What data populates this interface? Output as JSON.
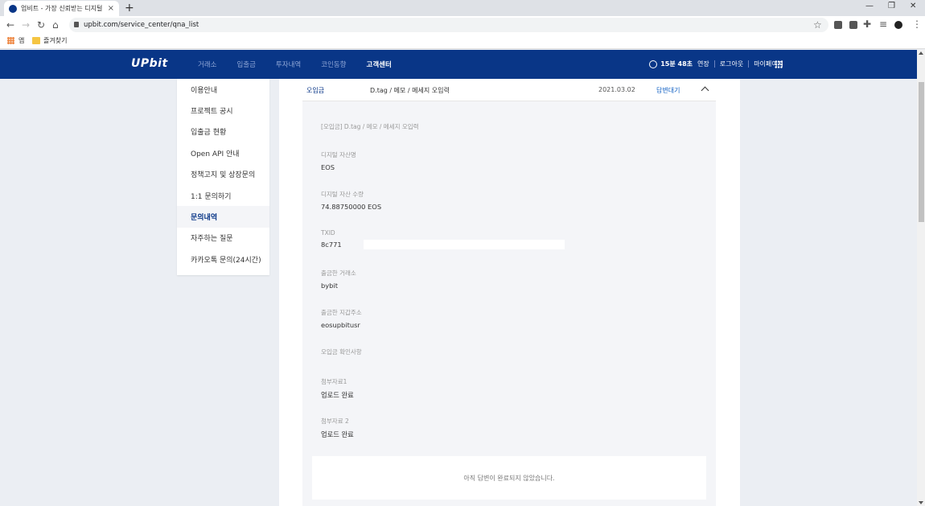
{
  "browser": {
    "tab_title": "업비트 - 가장 신뢰받는 디지털",
    "url": "upbit.com/service_center/qna_list",
    "bookmarks": {
      "apps_label": "앱",
      "folder_label": "즐겨찾기"
    }
  },
  "header": {
    "logo": "UPbit",
    "nav": [
      "거래소",
      "입출금",
      "투자내역",
      "코인동향",
      "고객센터"
    ],
    "active_nav": "고객센터",
    "session_timer": "15분 48초",
    "extend": "연장",
    "logout": "로그아웃",
    "mypage": "마이페이지"
  },
  "sidebar": {
    "items": [
      "이용안내",
      "프로젝트 공시",
      "입출금 현황",
      "Open API 안내",
      "정책고지 및 상장문의",
      "1:1 문의하기",
      "문의내역",
      "자주하는 질문",
      "카카오톡 문의(24시간)"
    ],
    "active": "문의내역"
  },
  "inquiry": {
    "category": "오입금",
    "subject": "D.tag / 메모 / 메세지 오입력",
    "date": "2021.03.02",
    "status": "답변대기",
    "body_title": "[오입금] D.tag / 메모 / 메세지 오입력",
    "fields": [
      {
        "label": "디지털 자산명",
        "value": "EOS"
      },
      {
        "label": "디지털 자산 수량",
        "value": "74.88750000 EOS"
      },
      {
        "label": "TXID",
        "value": "8c771"
      },
      {
        "label": "출금한 거래소",
        "value": "bybit"
      },
      {
        "label": "출금한 지갑주소",
        "value": "eosupbitusr"
      },
      {
        "label": "오입금 확인사항",
        "value": ""
      },
      {
        "label": "첨부자료1",
        "value": "업로드 완료"
      },
      {
        "label": "첨부자료 2",
        "value": "업로드 완료"
      }
    ],
    "answer_placeholder": "아직 답변이 완료되지 않았습니다."
  }
}
